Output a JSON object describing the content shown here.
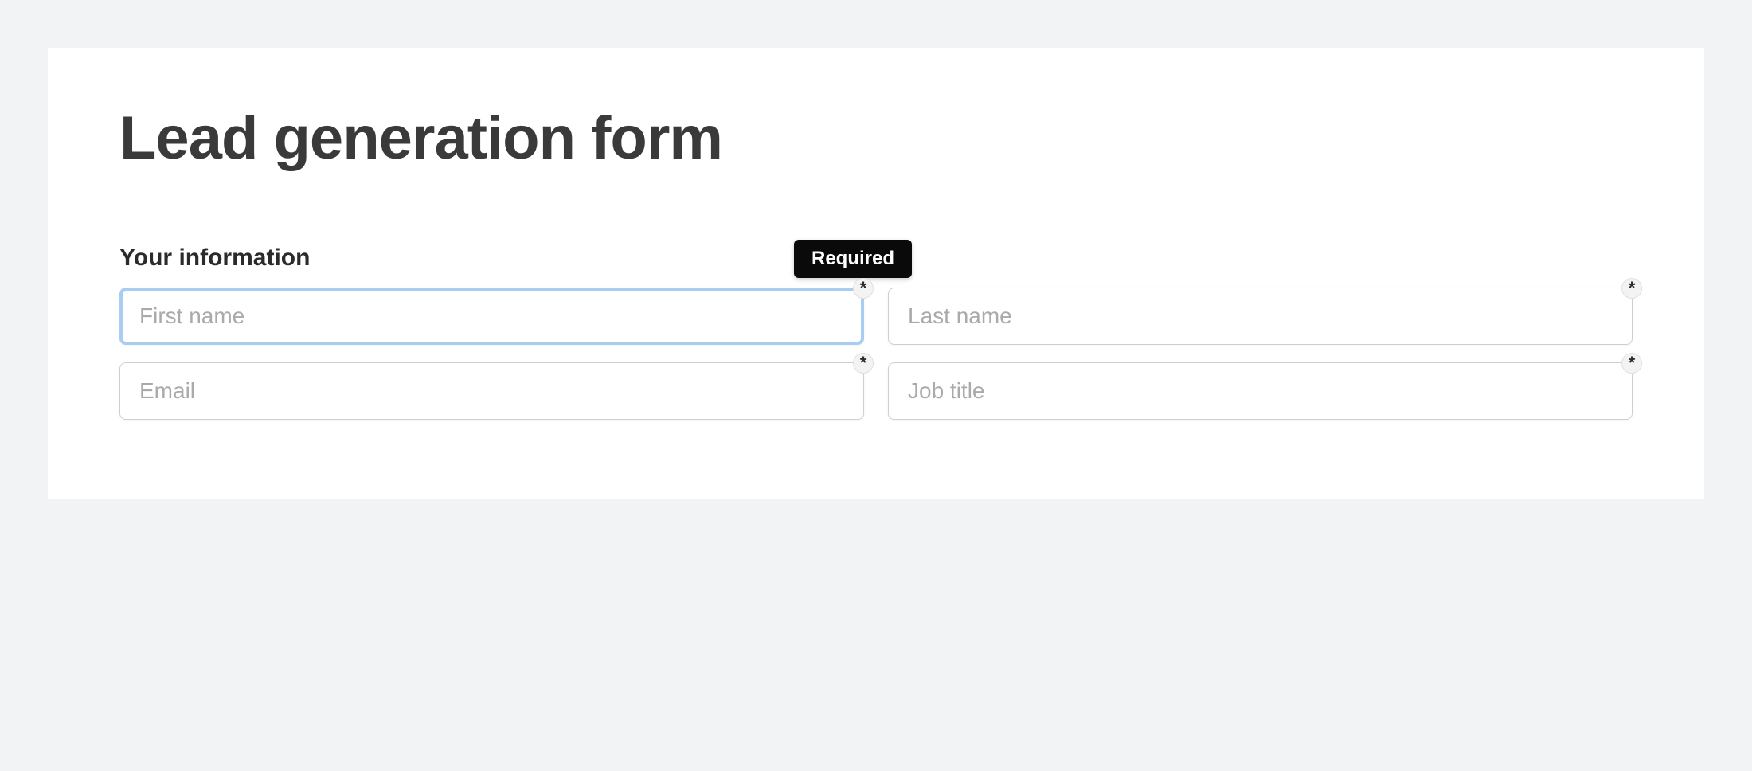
{
  "form": {
    "title": "Lead generation form",
    "section_label": "Your information",
    "tooltip_text": "Required",
    "fields": {
      "first_name": {
        "placeholder": "First name",
        "required_mark": "*"
      },
      "last_name": {
        "placeholder": "Last name",
        "required_mark": "*"
      },
      "email": {
        "placeholder": "Email",
        "required_mark": "*"
      },
      "job_title": {
        "placeholder": "Job title",
        "required_mark": "*"
      }
    }
  }
}
